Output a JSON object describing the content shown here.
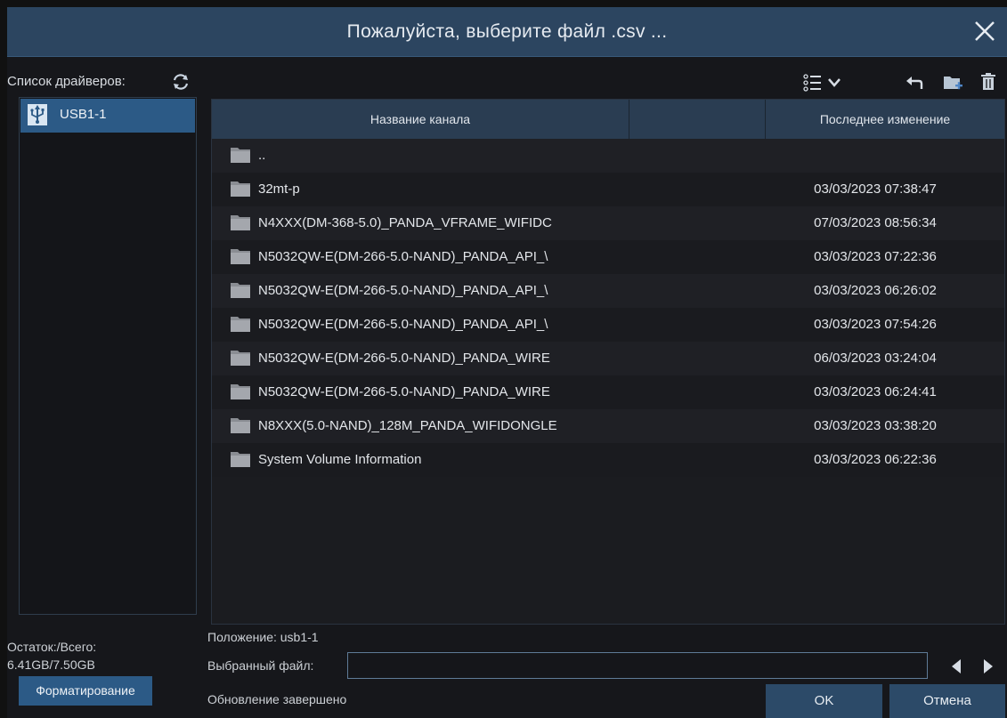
{
  "dialog": {
    "title": "Пожалуйста, выберите файл .csv ...",
    "close_icon": "close-icon"
  },
  "drivers": {
    "label": "Список драйверов:",
    "refresh_icon": "refresh-icon",
    "items": [
      {
        "name": "USB1-1",
        "icon": "usb-icon",
        "selected": true
      }
    ],
    "space_label": "Остаток:/Всего:",
    "space_value": "6.41GB/7.50GB",
    "format_button": "Форматирование"
  },
  "toolbar": {
    "view_icon": "list-view-icon",
    "dropdown_icon": "chevron-down-icon",
    "back_icon": "back-arrow-icon",
    "new_folder_icon": "new-folder-icon",
    "delete_icon": "trash-icon"
  },
  "table": {
    "headers": {
      "name": "Название канала",
      "middle": "",
      "modified": "Последнее изменение"
    },
    "rows": [
      {
        "name": "..",
        "modified": ""
      },
      {
        "name": "32mt-p",
        "modified": "03/03/2023 07:38:47"
      },
      {
        "name": "N4XXX(DM-368-5.0)_PANDA_VFRAME_WIFIDC",
        "modified": "07/03/2023 08:56:34"
      },
      {
        "name": "N5032QW-E(DM-266-5.0-NAND)_PANDA_API_\\",
        "modified": "03/03/2023 07:22:36"
      },
      {
        "name": "N5032QW-E(DM-266-5.0-NAND)_PANDA_API_\\",
        "modified": "03/03/2023 06:26:02"
      },
      {
        "name": "N5032QW-E(DM-266-5.0-NAND)_PANDA_API_\\",
        "modified": "03/03/2023 07:54:26"
      },
      {
        "name": "N5032QW-E(DM-266-5.0-NAND)_PANDA_WIRE",
        "modified": "06/03/2023 03:24:04"
      },
      {
        "name": "N5032QW-E(DM-266-5.0-NAND)_PANDA_WIRE",
        "modified": "03/03/2023 06:24:41"
      },
      {
        "name": "N8XXX(5.0-NAND)_128M_PANDA_WIFIDONGLE",
        "modified": "03/03/2023 03:38:20"
      },
      {
        "name": "System Volume Information",
        "modified": "03/03/2023 06:22:36"
      }
    ]
  },
  "footer": {
    "position": "Положение: usb1-1",
    "selected_file_label": "Выбранный файл:",
    "selected_file_value": "",
    "status": "Обновление завершено",
    "ok_button": "OK",
    "cancel_button": "Отмена",
    "prev_icon": "arrow-left-icon",
    "next_icon": "arrow-right-icon"
  },
  "colors": {
    "accent": "#2c5a86",
    "header": "#2c4560",
    "background": "#16171b"
  }
}
